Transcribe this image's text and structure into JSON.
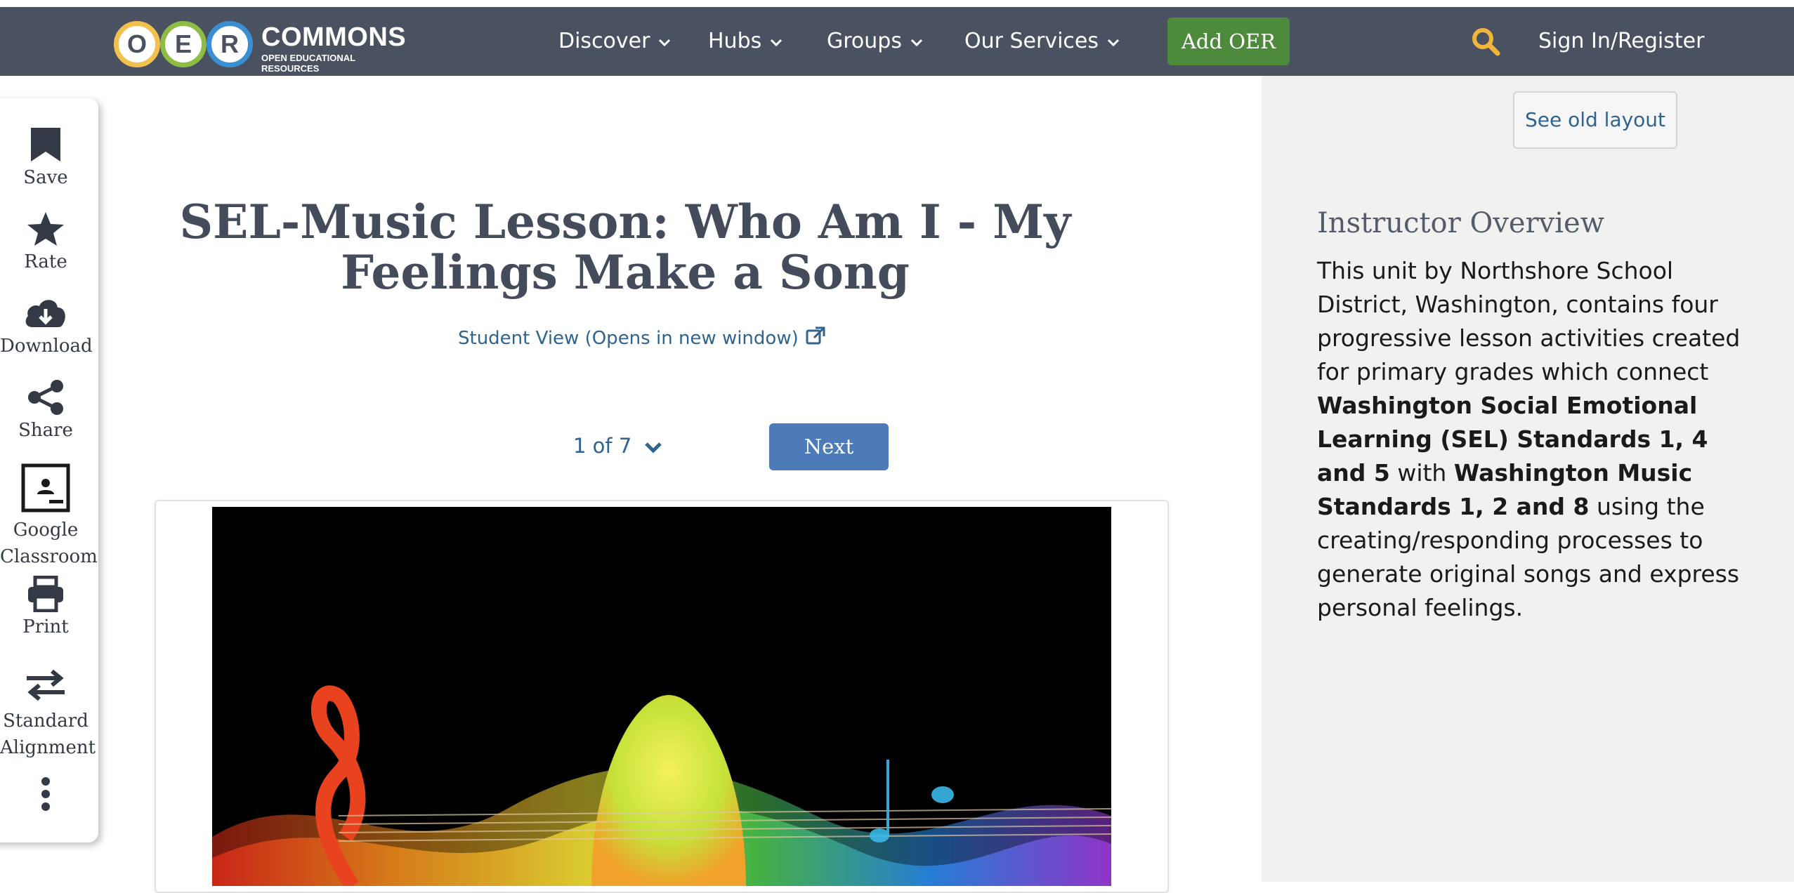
{
  "header": {
    "logo": {
      "letters": [
        "O",
        "E",
        "R"
      ],
      "word": "COMMONS",
      "tagline": "OPEN EDUCATIONAL RESOURCES"
    },
    "nav": [
      {
        "label": "Discover"
      },
      {
        "label": "Hubs"
      },
      {
        "label": "Groups"
      },
      {
        "label": "Our Services"
      }
    ],
    "add_button": "Add OER",
    "signin": "Sign In/Register",
    "icons": {
      "search": "search-icon",
      "chevron": "chevron-down-icon"
    },
    "colors": {
      "navbar": "#4a5262",
      "add_button": "#4e8a3c",
      "search": "#f2b53a"
    }
  },
  "toolbar": {
    "items": [
      {
        "label": "Save",
        "icon": "bookmark-icon"
      },
      {
        "label": "Rate",
        "icon": "star-icon"
      },
      {
        "label": "Download",
        "icon": "cloud-download-icon"
      },
      {
        "label": "Share",
        "icon": "share-icon"
      },
      {
        "label": "Google Classroom",
        "icon": "google-classroom-icon"
      },
      {
        "label": "Print",
        "icon": "print-icon"
      },
      {
        "label": "Standard Alignment",
        "icon": "exchange-arrows-icon"
      },
      {
        "label": "",
        "icon": "more-vertical-icon"
      }
    ]
  },
  "main": {
    "title": "SEL-Music Lesson: Who Am I - My Feelings Make a Song",
    "student_view": "Student View (Opens in new window)",
    "pager": {
      "current": "1 of 7"
    },
    "next_button": "Next",
    "image": {
      "description_icon": "music-notes-rainbow-image"
    }
  },
  "right_panel": {
    "old_layout_button": "See old layout",
    "overview_title": "Instructor Overview",
    "overview": {
      "p1": "This unit by Northshore School District, Washington, contains four progressive lesson activities created for primary grades which connect ",
      "b1": "Washington Social Emotional Learning (SEL) Standards 1, 4 and 5",
      "p2": " with ",
      "b2": "Washington Music Standards 1, 2 and 8",
      "p3": " using the creating/responding processes to generate original songs and express personal feelings."
    }
  }
}
